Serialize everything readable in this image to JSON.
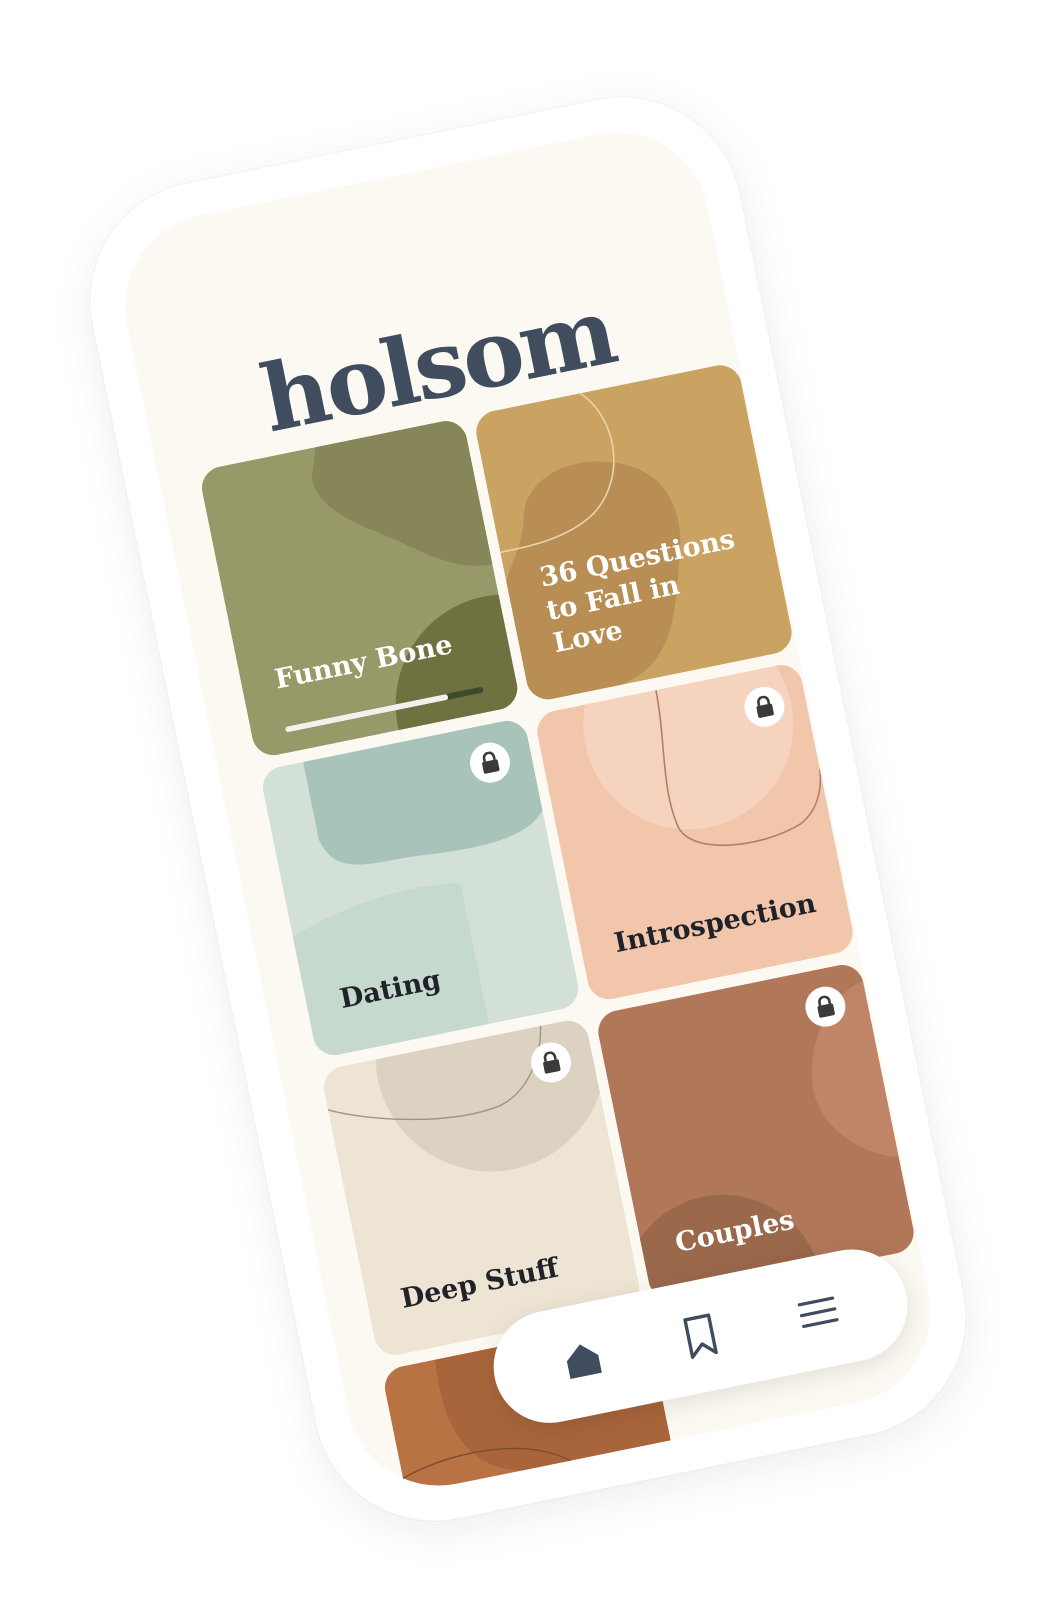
{
  "app": {
    "logo_text": "holsom",
    "logo_color": "#3f4d5e"
  },
  "cards": [
    {
      "label": "Funny Bone",
      "locked": false,
      "progress": 0.82,
      "text_color": "#ffffff",
      "base": "#979a68",
      "blob1": "#868659",
      "blob2": "#6f7140"
    },
    {
      "label": "36 Questions to Fall in Love",
      "locked": false,
      "text_color": "#ffffff",
      "base": "#caa262",
      "blob1": "#b88e55",
      "line": "#e8d4ae"
    },
    {
      "label": "Dating",
      "locked": true,
      "text_color": "#1f2228",
      "base": "#d3e0d7",
      "blob1": "#a8c3ba",
      "blob2": "#c5d9cf"
    },
    {
      "label": "Introspection",
      "locked": true,
      "text_color": "#1f2228",
      "base": "#f2c6ab",
      "blob1": "#f5d3be",
      "line": "#b67e66"
    },
    {
      "label": "Deep Stuff",
      "locked": true,
      "text_color": "#1f2228",
      "base": "#ede4d4",
      "blob1": "#dcd2c1",
      "line": "#9d9488"
    },
    {
      "label": "Couples",
      "locked": true,
      "text_color": "#ffffff",
      "base": "#b07759",
      "blob1": "#c08466",
      "blob2": "#9a684b"
    },
    {
      "label": "",
      "locked": true,
      "text_color": "#ffffff",
      "base": "#b97244",
      "blob1": "#a8653b",
      "line": "#7d4c2e"
    }
  ],
  "nav": {
    "items": [
      {
        "icon": "home-icon",
        "active": true
      },
      {
        "icon": "bookmark-icon",
        "active": false
      },
      {
        "icon": "menu-icon",
        "active": false
      }
    ],
    "icon_color": "#3f4d5e"
  }
}
